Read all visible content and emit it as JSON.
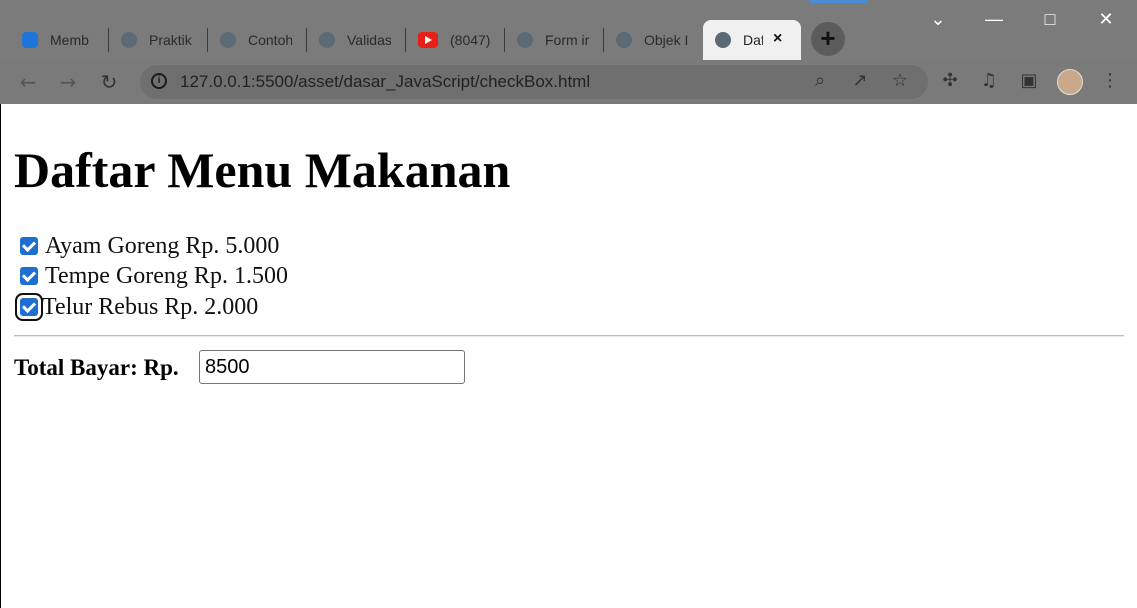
{
  "browser": {
    "tabs": [
      {
        "label": "Memb",
        "icon": "blue-app-icon"
      },
      {
        "label": "Praktik",
        "icon": "globe-icon"
      },
      {
        "label": "Contoh",
        "icon": "globe-icon"
      },
      {
        "label": "Validas",
        "icon": "globe-icon"
      },
      {
        "label": "(8047)",
        "icon": "youtube-icon"
      },
      {
        "label": "Form ir",
        "icon": "globe-icon"
      },
      {
        "label": "Objek I",
        "icon": "globe-icon"
      },
      {
        "label": "Daf",
        "icon": "globe-icon",
        "active": true
      }
    ],
    "new_tab_label": "+",
    "address": "127.0.0.1:5500/asset/dasar_JavaScript/checkBox.html",
    "window_controls": [
      "minimize",
      "maximize",
      "close"
    ]
  },
  "page": {
    "title": "Daftar Menu Makanan",
    "items": [
      {
        "label": "Ayam Goreng Rp. 5.000",
        "checked": true
      },
      {
        "label": "Tempe Goreng Rp. 1.500",
        "checked": true
      },
      {
        "label": "Telur Rebus Rp. 2.000",
        "checked": true,
        "focused": true
      }
    ],
    "total_label": "Total Bayar: Rp.",
    "total_value": "8500"
  },
  "colors": {
    "checkbox_blue": "#1f6fd1",
    "browser_gray": "#7b7b7b"
  }
}
